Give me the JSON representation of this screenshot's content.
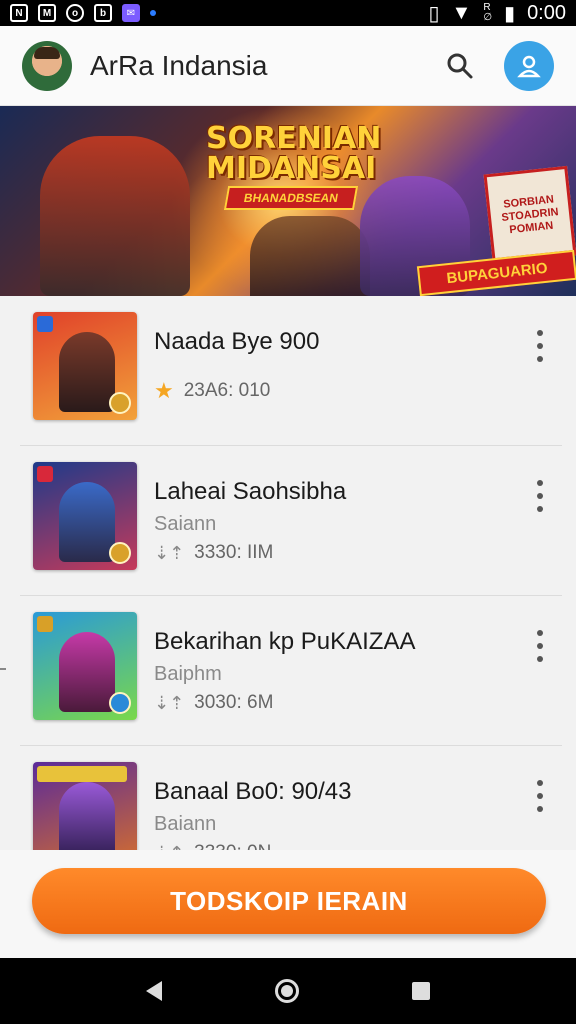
{
  "status_bar": {
    "time": "0:00",
    "icons": [
      "notification-icon",
      "photo-icon",
      "sync-icon",
      "app-icon",
      "chat-icon",
      "dot-icon"
    ],
    "network_label": "R",
    "network_sub": "∅"
  },
  "app_bar": {
    "title": "ArRa Indansia"
  },
  "banner": {
    "title_line1": "SORENIAN",
    "title_line2": "MIDANSAI",
    "tag": "BHANADBSEAN",
    "promo_text": "SORBIAN STOADRIN POMIAN",
    "ribbon": "BUPAGUARIO"
  },
  "list": {
    "items": [
      {
        "title": "Naada Bye 900",
        "subtitle": "",
        "meta": "23A6: 010",
        "meta_icon": "star-icon"
      },
      {
        "title": "Laheai Saohsibha",
        "subtitle": "Saiann",
        "meta": "3330: IIM",
        "meta_icon": "download-icon"
      },
      {
        "title": "Bekarihan kp PuKAIZAA",
        "subtitle": "Baiphm",
        "meta": "3030: 6M",
        "meta_icon": "download-icon"
      },
      {
        "title": "Banaal Bo0: 90/43",
        "subtitle": "Baiann",
        "meta": "3330: 0N",
        "meta_icon": "download-icon"
      }
    ]
  },
  "cta": {
    "label": "TODSKOIP IERAIN"
  },
  "colors": {
    "accent": "#f07a1e",
    "profile": "#3aa3e6",
    "star": "#f5a623"
  }
}
